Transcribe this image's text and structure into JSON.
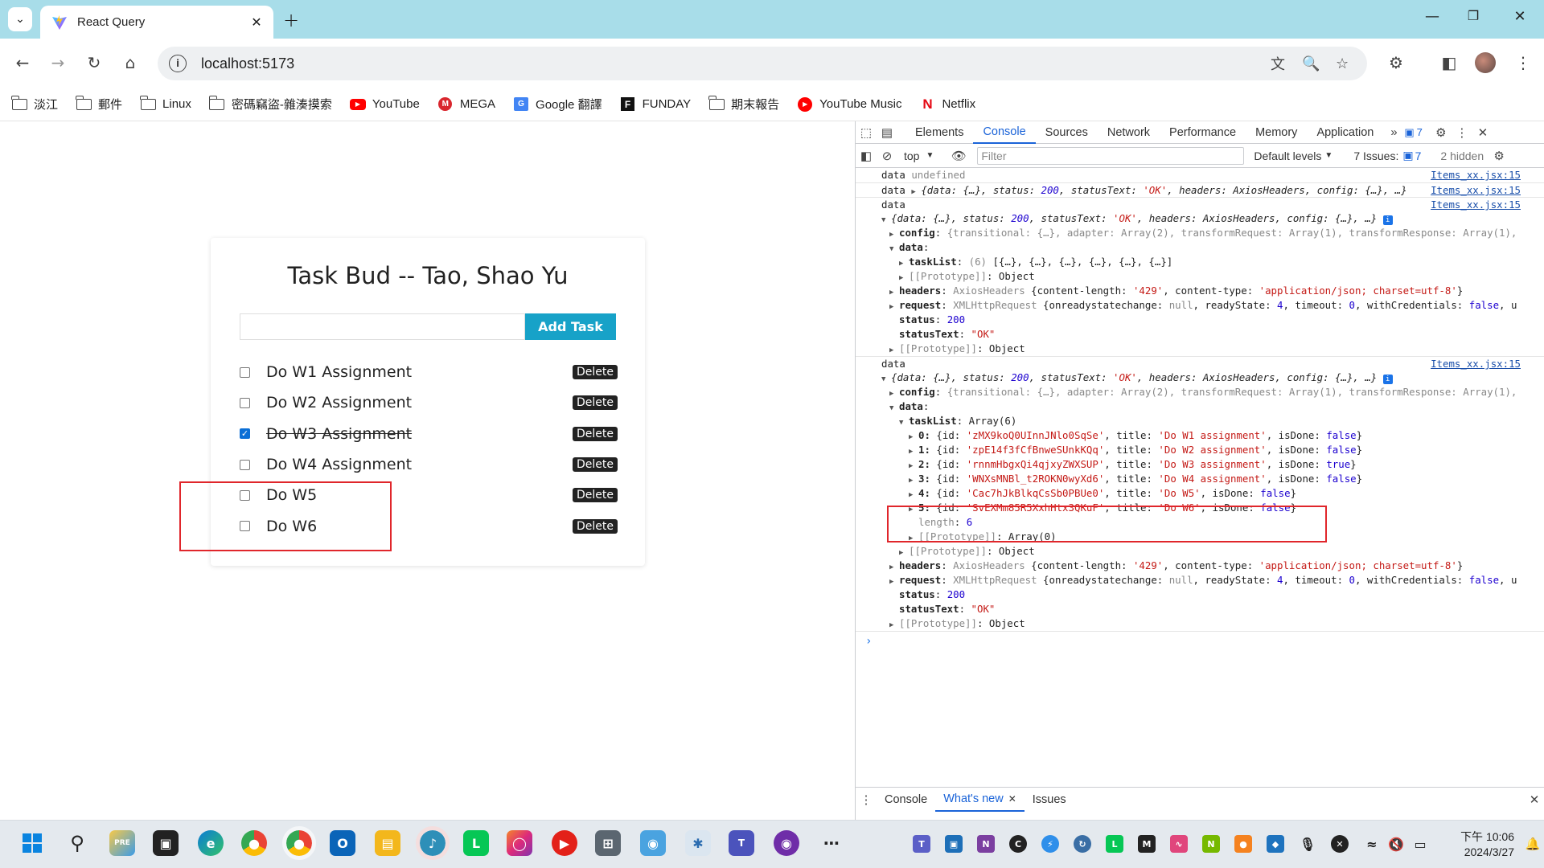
{
  "browser": {
    "tab_title": "React Query",
    "url": "localhost:5173",
    "bookmarks": [
      {
        "label": "淡江",
        "icon": "folder-icon"
      },
      {
        "label": "郵件",
        "icon": "folder-icon"
      },
      {
        "label": "Linux",
        "icon": "folder-icon"
      },
      {
        "label": "密碼竊盜-雜湊摸索",
        "icon": "folder-icon"
      },
      {
        "label": "YouTube",
        "icon": "youtube-icon"
      },
      {
        "label": "MEGA",
        "icon": "mega-icon"
      },
      {
        "label": "Google 翻譯",
        "icon": "google-translate-icon"
      },
      {
        "label": "FUNDAY",
        "icon": "funday-icon"
      },
      {
        "label": "期末報告",
        "icon": "folder-icon"
      },
      {
        "label": "YouTube Music",
        "icon": "youtube-music-icon"
      },
      {
        "label": "Netflix",
        "icon": "netflix-icon"
      }
    ]
  },
  "app": {
    "title": "Task Bud -- Tao, Shao Yu",
    "input_placeholder": "",
    "add_button": "Add Task",
    "delete_label": "Delete",
    "tasks": [
      {
        "title": "Do W1 Assignment",
        "done": false
      },
      {
        "title": "Do W2 Assignment",
        "done": false
      },
      {
        "title": "Do W3 Assignment",
        "done": true
      },
      {
        "title": "Do W4 Assignment",
        "done": false
      },
      {
        "title": "Do W5",
        "done": false
      },
      {
        "title": "Do W6",
        "done": false
      }
    ]
  },
  "devtools": {
    "tabs": [
      "Elements",
      "Console",
      "Sources",
      "Network",
      "Performance",
      "Memory",
      "Application"
    ],
    "active_tab": "Console",
    "message_count": "7",
    "context": "top",
    "filter_placeholder": "Filter",
    "levels": "Default levels",
    "issues_label": "7 Issues:",
    "issues_count": "7",
    "hidden_label": "2 hidden",
    "drawer_tabs": [
      "Console",
      "What's new",
      "Issues"
    ],
    "drawer_active": "What's new",
    "source_link": "Items_xx.jsx:15",
    "log_label": "data",
    "undefined_text": "undefined",
    "tasklist_items": [
      {
        "idx": "0",
        "id": "'zMX9koQ0UInnJNlo0SqSe'",
        "title": "'Do W1 assignment'",
        "isDone": "false"
      },
      {
        "idx": "1",
        "id": "'zpE14f3fCfBnweSUnkKQq'",
        "title": "'Do W2 assignment'",
        "isDone": "false"
      },
      {
        "idx": "2",
        "id": "'rnnmHbgxQi4qjxyZWXSUP'",
        "title": "'Do W3 assignment'",
        "isDone": "true"
      },
      {
        "idx": "3",
        "id": "'WNXsMNBl_t2ROKN0wyXd6'",
        "title": "'Do W4 assignment'",
        "isDone": "false"
      },
      {
        "idx": "4",
        "id": "'Cac7hJkBlkqCsSb0PBUe0'",
        "title": "'Do W5'",
        "isDone": "false"
      },
      {
        "idx": "5",
        "id": "'SvEXMm85R5XxhHtx3QKuF'",
        "title": "'Do W6'",
        "isDone": "false"
      }
    ]
  },
  "taskbar": {
    "time": "下午 10:06",
    "date": "2024/3/27"
  }
}
